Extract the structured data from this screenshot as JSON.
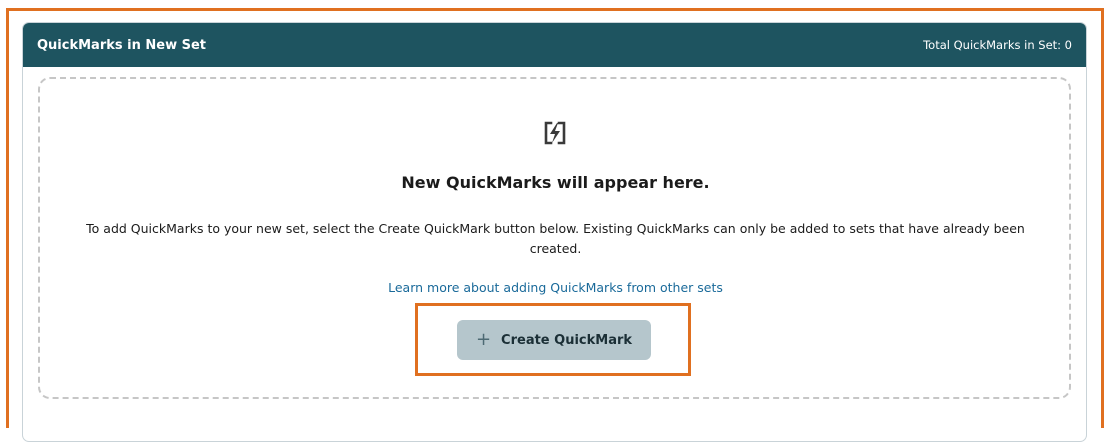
{
  "header": {
    "title": "QuickMarks in New Set",
    "total_label": "Total QuickMarks in Set: 0"
  },
  "empty_state": {
    "icon": "quickmark-icon",
    "title": "New QuickMarks will appear here.",
    "description": "To add QuickMarks to your new set, select the Create QuickMark button below. Existing QuickMarks can only be added to sets that have already been created.",
    "learn_more_link": "Learn more about adding QuickMarks from other sets"
  },
  "create_button": {
    "icon": "plus-icon",
    "label": "Create QuickMark"
  },
  "colors": {
    "header_bg": "#1e5460",
    "button_bg": "#b5c6cc",
    "link": "#1a6a9a",
    "highlight": "#e07020"
  }
}
